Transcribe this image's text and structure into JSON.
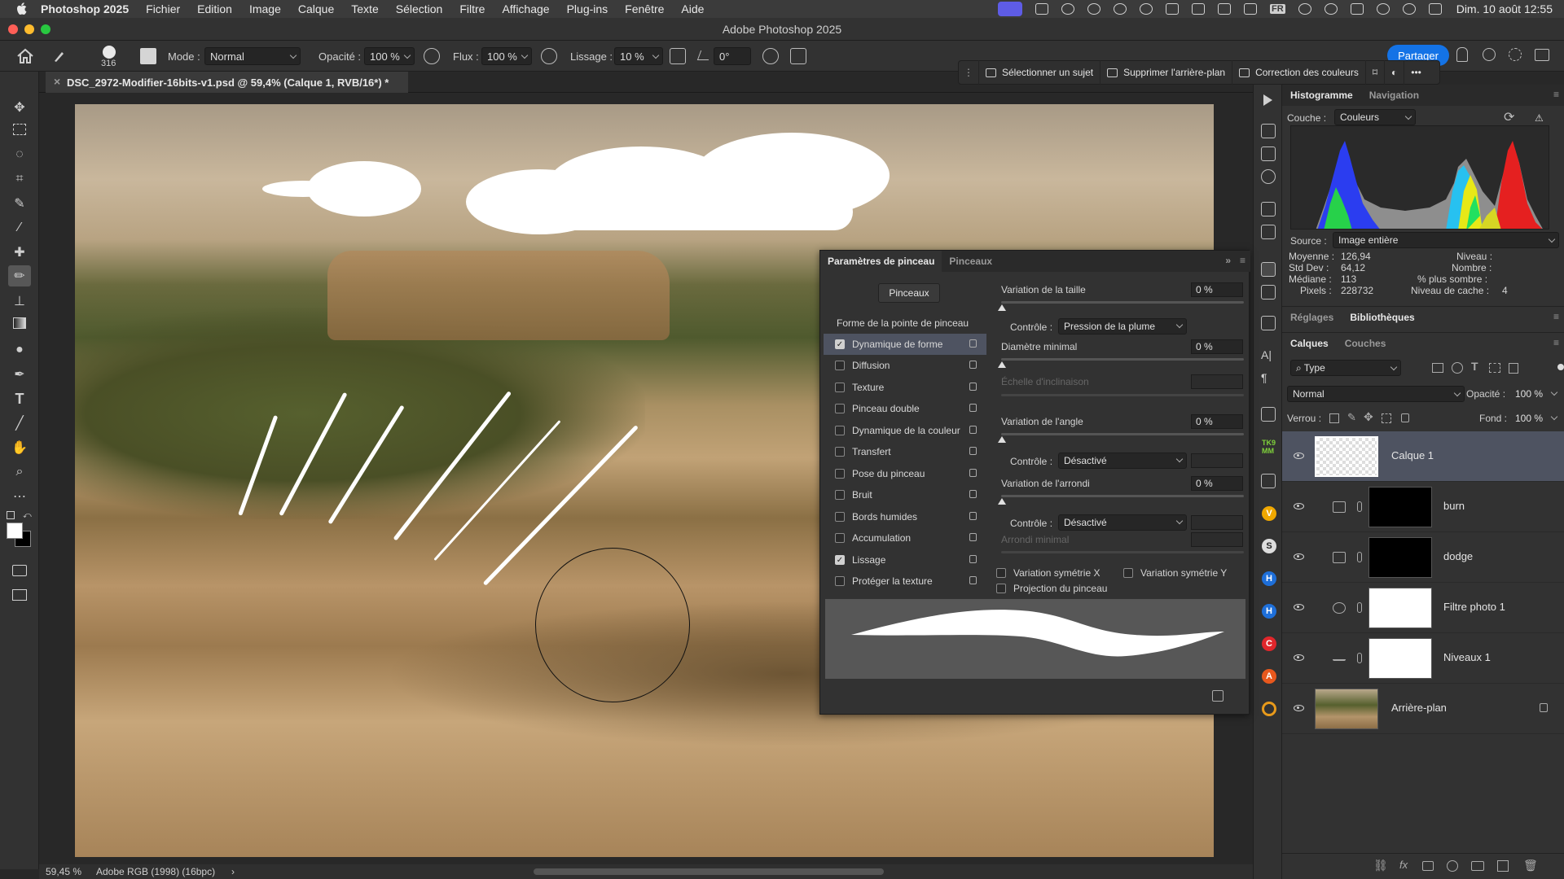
{
  "menubar": {
    "app_name": "Photoshop 2025",
    "items": [
      "Fichier",
      "Edition",
      "Image",
      "Calque",
      "Texte",
      "Sélection",
      "Filtre",
      "Affichage",
      "Plug-ins",
      "Fenêtre",
      "Aide"
    ],
    "input_lang": "FR",
    "clock": "Dim. 10 août  12:55"
  },
  "window": {
    "title": "Adobe Photoshop 2025"
  },
  "options": {
    "brush_size": "316",
    "mode_label": "Mode :",
    "mode_value": "Normal",
    "opacity_label": "Opacité :",
    "opacity_value": "100 %",
    "flow_label": "Flux :",
    "flow_value": "100 %",
    "smoothing_label": "Lissage :",
    "smoothing_value": "10 %",
    "angle_value": "0°",
    "share_label": "Partager"
  },
  "document": {
    "tab_title": "DSC_2972-Modifier-16bits-v1.psd @ 59,4% (Calque 1, RVB/16*) *"
  },
  "contextual_bar": {
    "select_subject": "Sélectionner un sujet",
    "remove_bg": "Supprimer l'arrière-plan",
    "color_correction": "Correction des couleurs"
  },
  "status": {
    "zoom": "59,45 %",
    "profile": "Adobe RGB (1998) (16bpc)",
    "arrow": "›"
  },
  "histogram_panel": {
    "tabs": [
      "Histogramme",
      "Navigation"
    ],
    "channel_label": "Couche :",
    "channel_value": "Couleurs",
    "source_label": "Source :",
    "source_value": "Image entière",
    "stats": {
      "mean_label": "Moyenne :",
      "mean": "126,94",
      "std_label": "Std Dev :",
      "std": "64,12",
      "median_label": "Médiane :",
      "median": "113",
      "pixels_label": "Pixels :",
      "pixels": "228732",
      "level_label": "Niveau :",
      "count_label": "Nombre :",
      "percentile_label": "% plus sombre :",
      "cache_label": "Niveau de cache :",
      "cache": "4"
    }
  },
  "mid_tabs": [
    "Réglages",
    "Bibliothèques"
  ],
  "layers_panel": {
    "tabs": [
      "Calques",
      "Couches"
    ],
    "filter_value": "Type",
    "blend_value": "Normal",
    "opacity_label": "Opacité :",
    "opacity_value": "100 %",
    "lock_label": "Verrou :",
    "fill_label": "Fond :",
    "fill_value": "100 %",
    "layers": [
      {
        "name": "Calque 1"
      },
      {
        "name": "burn"
      },
      {
        "name": "dodge"
      },
      {
        "name": "Filtre photo 1"
      },
      {
        "name": "Niveaux 1"
      },
      {
        "name": "Arrière-plan"
      }
    ]
  },
  "brush_settings": {
    "tabs": [
      "Paramètres de pinceau",
      "Pinceaux"
    ],
    "brushes_button": "Pinceaux",
    "tip_shape": "Forme de la pointe de pinceau",
    "options": [
      {
        "label": "Dynamique de forme",
        "checked": true
      },
      {
        "label": "Diffusion",
        "checked": false
      },
      {
        "label": "Texture",
        "checked": false
      },
      {
        "label": "Pinceau double",
        "checked": false
      },
      {
        "label": "Dynamique de la couleur",
        "checked": false
      },
      {
        "label": "Transfert",
        "checked": false
      },
      {
        "label": "Pose du pinceau",
        "checked": false
      },
      {
        "label": "Bruit",
        "checked": false
      },
      {
        "label": "Bords humides",
        "checked": false
      },
      {
        "label": "Accumulation",
        "checked": false
      },
      {
        "label": "Lissage",
        "checked": true
      },
      {
        "label": "Protéger la texture",
        "checked": false
      }
    ],
    "size_jitter_label": "Variation de la taille",
    "size_jitter_value": "0 %",
    "control_label": "Contrôle :",
    "control_pen_pressure": "Pression de la plume",
    "min_diameter_label": "Diamètre minimal",
    "min_diameter_value": "0 %",
    "tilt_scale_label": "Échelle d'inclinaison",
    "angle_jitter_label": "Variation de l'angle",
    "angle_jitter_value": "0 %",
    "control_off": "Désactivé",
    "roundness_jitter_label": "Variation de l'arrondi",
    "roundness_jitter_value": "0 %",
    "min_roundness_label": "Arrondi minimal",
    "flip_x_label": "Variation symétrie X",
    "flip_y_label": "Variation symétrie Y",
    "projection_label": "Projection du pinceau"
  },
  "plugin_icons": [
    "TK9 MM",
    "V",
    "S",
    "H",
    "H",
    "C",
    "A",
    "flower"
  ]
}
